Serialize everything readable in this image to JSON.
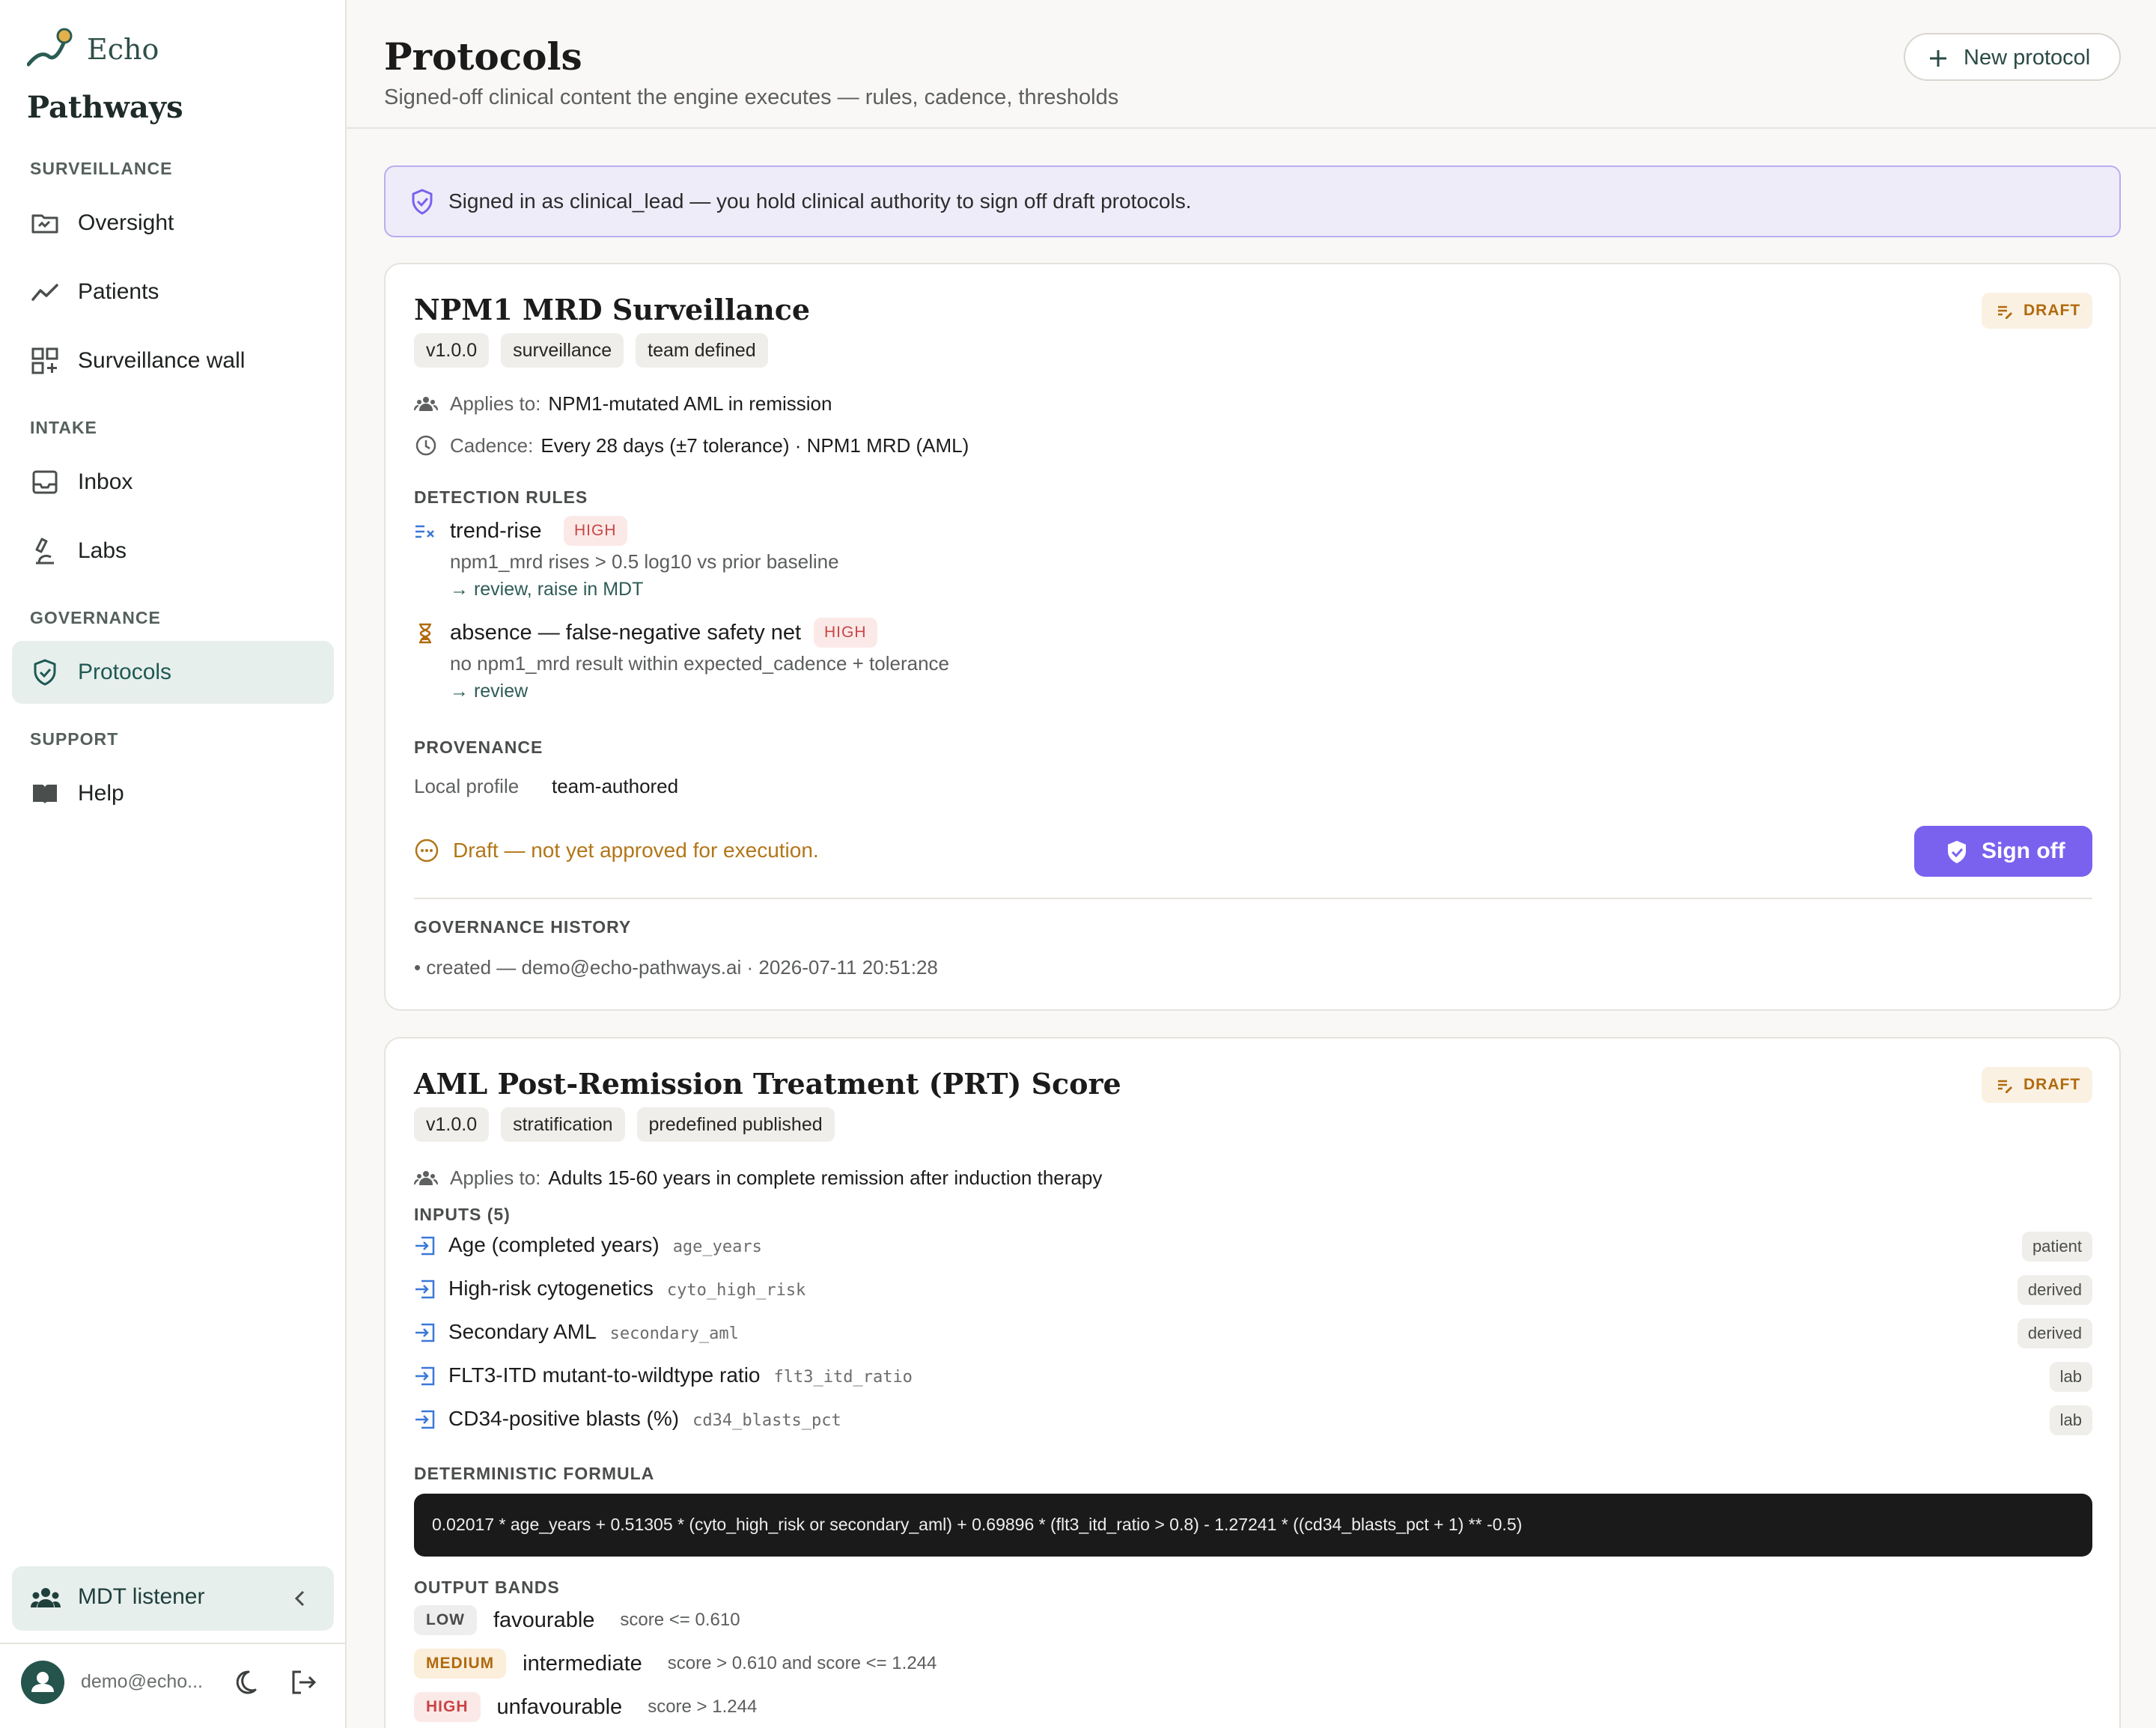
{
  "brand": {
    "line1": "Echo",
    "line2": "Pathways"
  },
  "sidebar": {
    "sections": [
      {
        "title": "SURVEILLANCE"
      },
      {
        "title": "INTAKE"
      },
      {
        "title": "GOVERNANCE"
      },
      {
        "title": "SUPPORT"
      }
    ],
    "items": [
      {
        "label": "Oversight",
        "icon": "oversight-icon"
      },
      {
        "label": "Patients",
        "icon": "trend-icon"
      },
      {
        "label": "Surveillance wall",
        "icon": "grid-add-icon"
      },
      {
        "label": "Inbox",
        "icon": "inbox-icon"
      },
      {
        "label": "Labs",
        "icon": "microscope-icon"
      },
      {
        "label": "Protocols",
        "icon": "shield-check-icon",
        "active": true
      },
      {
        "label": "Help",
        "icon": "book-icon"
      }
    ],
    "mdt": {
      "label": "MDT listener"
    },
    "user": {
      "email": "demo@echo..."
    }
  },
  "header": {
    "title": "Protocols",
    "subtitle": "Signed-off clinical content the engine executes — rules, cadence, thresholds",
    "new_button": "New protocol"
  },
  "banner": {
    "text": "Signed in as clinical_lead — you hold clinical authority to sign off draft protocols."
  },
  "colors": {
    "accent": "#7a62ef",
    "brand": "#1f5952",
    "draft": "#b06a0e",
    "high": "#c84545"
  },
  "card1": {
    "title": "NPM1 MRD Surveillance",
    "status": "DRAFT",
    "chips": [
      "v1.0.0",
      "surveillance",
      "team defined"
    ],
    "applies_label": "Applies to:",
    "applies_value": "NPM1-mutated AML in remission",
    "cadence_label": "Cadence:",
    "cadence_value": "Every 28 days (±7 tolerance) · NPM1 MRD (AML)",
    "rules_heading": "DETECTION RULES",
    "rules": [
      {
        "name": "trend-rise",
        "severity": "HIGH",
        "desc": "npm1_mrd rises > 0.5 log10 vs prior baseline",
        "action": "→ review, raise in MDT"
      },
      {
        "name": "absence — false-negative safety net",
        "severity": "HIGH",
        "desc": "no npm1_mrd result within expected_cadence + tolerance",
        "action": "→ review"
      }
    ],
    "provenance_heading": "PROVENANCE",
    "provenance_key": "Local profile",
    "provenance_value": "team-authored",
    "draft_note": "Draft — not yet approved for execution.",
    "signoff_label": "Sign off",
    "history_heading": "GOVERNANCE HISTORY",
    "history": [
      "• created — demo@echo-pathways.ai · 2026-07-11 20:51:28"
    ]
  },
  "card2": {
    "title": "AML Post-Remission Treatment (PRT) Score",
    "status": "DRAFT",
    "chips": [
      "v1.0.0",
      "stratification",
      "predefined published"
    ],
    "applies_label": "Applies to:",
    "applies_value": "Adults 15-60 years in complete remission after induction therapy",
    "inputs_heading": "INPUTS (5)",
    "inputs": [
      {
        "label": "Age (completed years)",
        "key": "age_years",
        "source": "patient"
      },
      {
        "label": "High-risk cytogenetics",
        "key": "cyto_high_risk",
        "source": "derived"
      },
      {
        "label": "Secondary AML",
        "key": "secondary_aml",
        "source": "derived"
      },
      {
        "label": "FLT3-ITD mutant-to-wildtype ratio",
        "key": "flt3_itd_ratio",
        "source": "lab"
      },
      {
        "label": "CD34-positive blasts (%)",
        "key": "cd34_blasts_pct",
        "source": "lab"
      }
    ],
    "formula_heading": "DETERMINISTIC FORMULA",
    "formula": "0.02017 * age_years + 0.51305 * (cyto_high_risk or secondary_aml) + 0.69896 * (flt3_itd_ratio > 0.8) - 1.27241 * ((cd34_blasts_pct + 1) ** -0.5)",
    "bands_heading": "OUTPUT BANDS",
    "bands": [
      {
        "tag": "LOW",
        "name": "favourable",
        "cond": "score <= 0.610"
      },
      {
        "tag": "MEDIUM",
        "name": "intermediate",
        "cond": "score > 0.610 and score <= 1.244"
      },
      {
        "tag": "HIGH",
        "name": "unfavourable",
        "cond": "score > 1.244"
      }
    ]
  }
}
